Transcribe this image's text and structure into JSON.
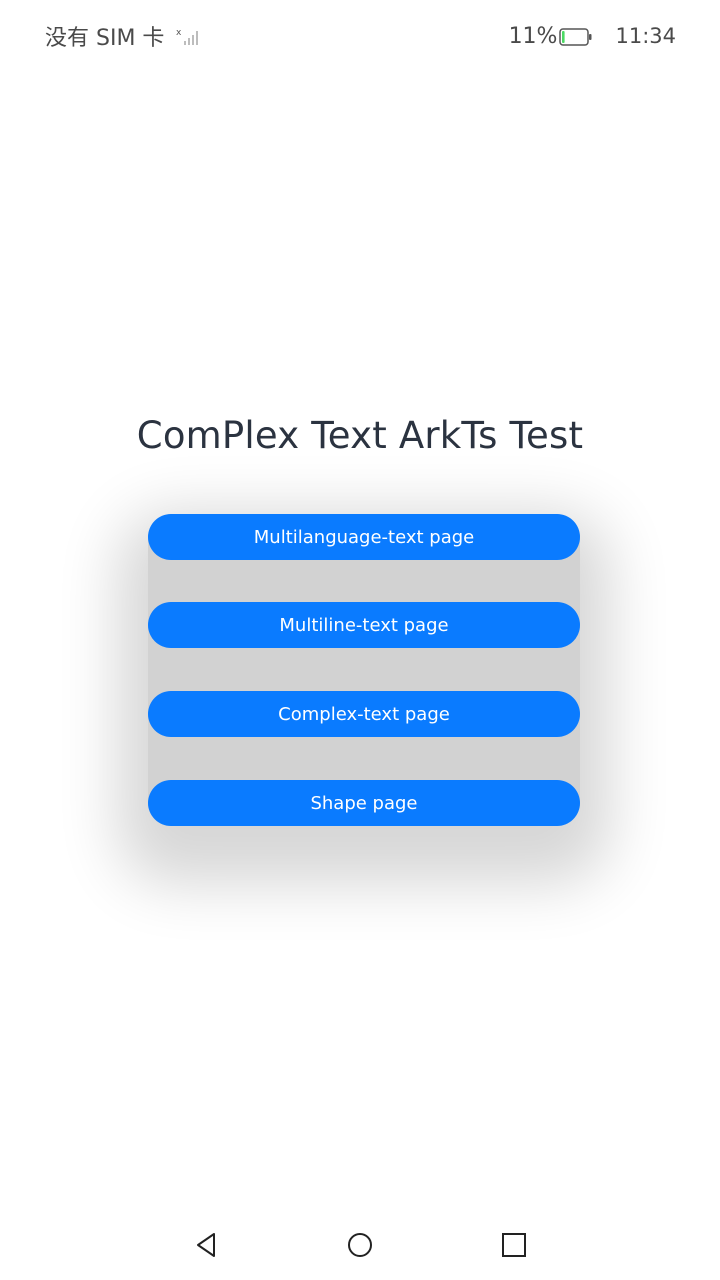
{
  "status_bar": {
    "carrier": "没有 SIM 卡",
    "battery_percent": "11%",
    "battery_level": 0.11,
    "time": "11:34"
  },
  "page": {
    "title": "ComPlex Text ArkTs Test"
  },
  "buttons": [
    {
      "label": "Multilanguage-text page"
    },
    {
      "label": "Multiline-text page"
    },
    {
      "label": "Complex-text page"
    },
    {
      "label": "Shape page"
    }
  ],
  "colors": {
    "button_bg": "#0a7bff",
    "button_text": "#ffffff",
    "title_text": "#2b3340",
    "battery_fill": "#4cd964"
  },
  "nav_bar": {
    "back_icon": "back-triangle-icon",
    "home_icon": "home-circle-icon",
    "recent_icon": "recent-square-icon"
  }
}
